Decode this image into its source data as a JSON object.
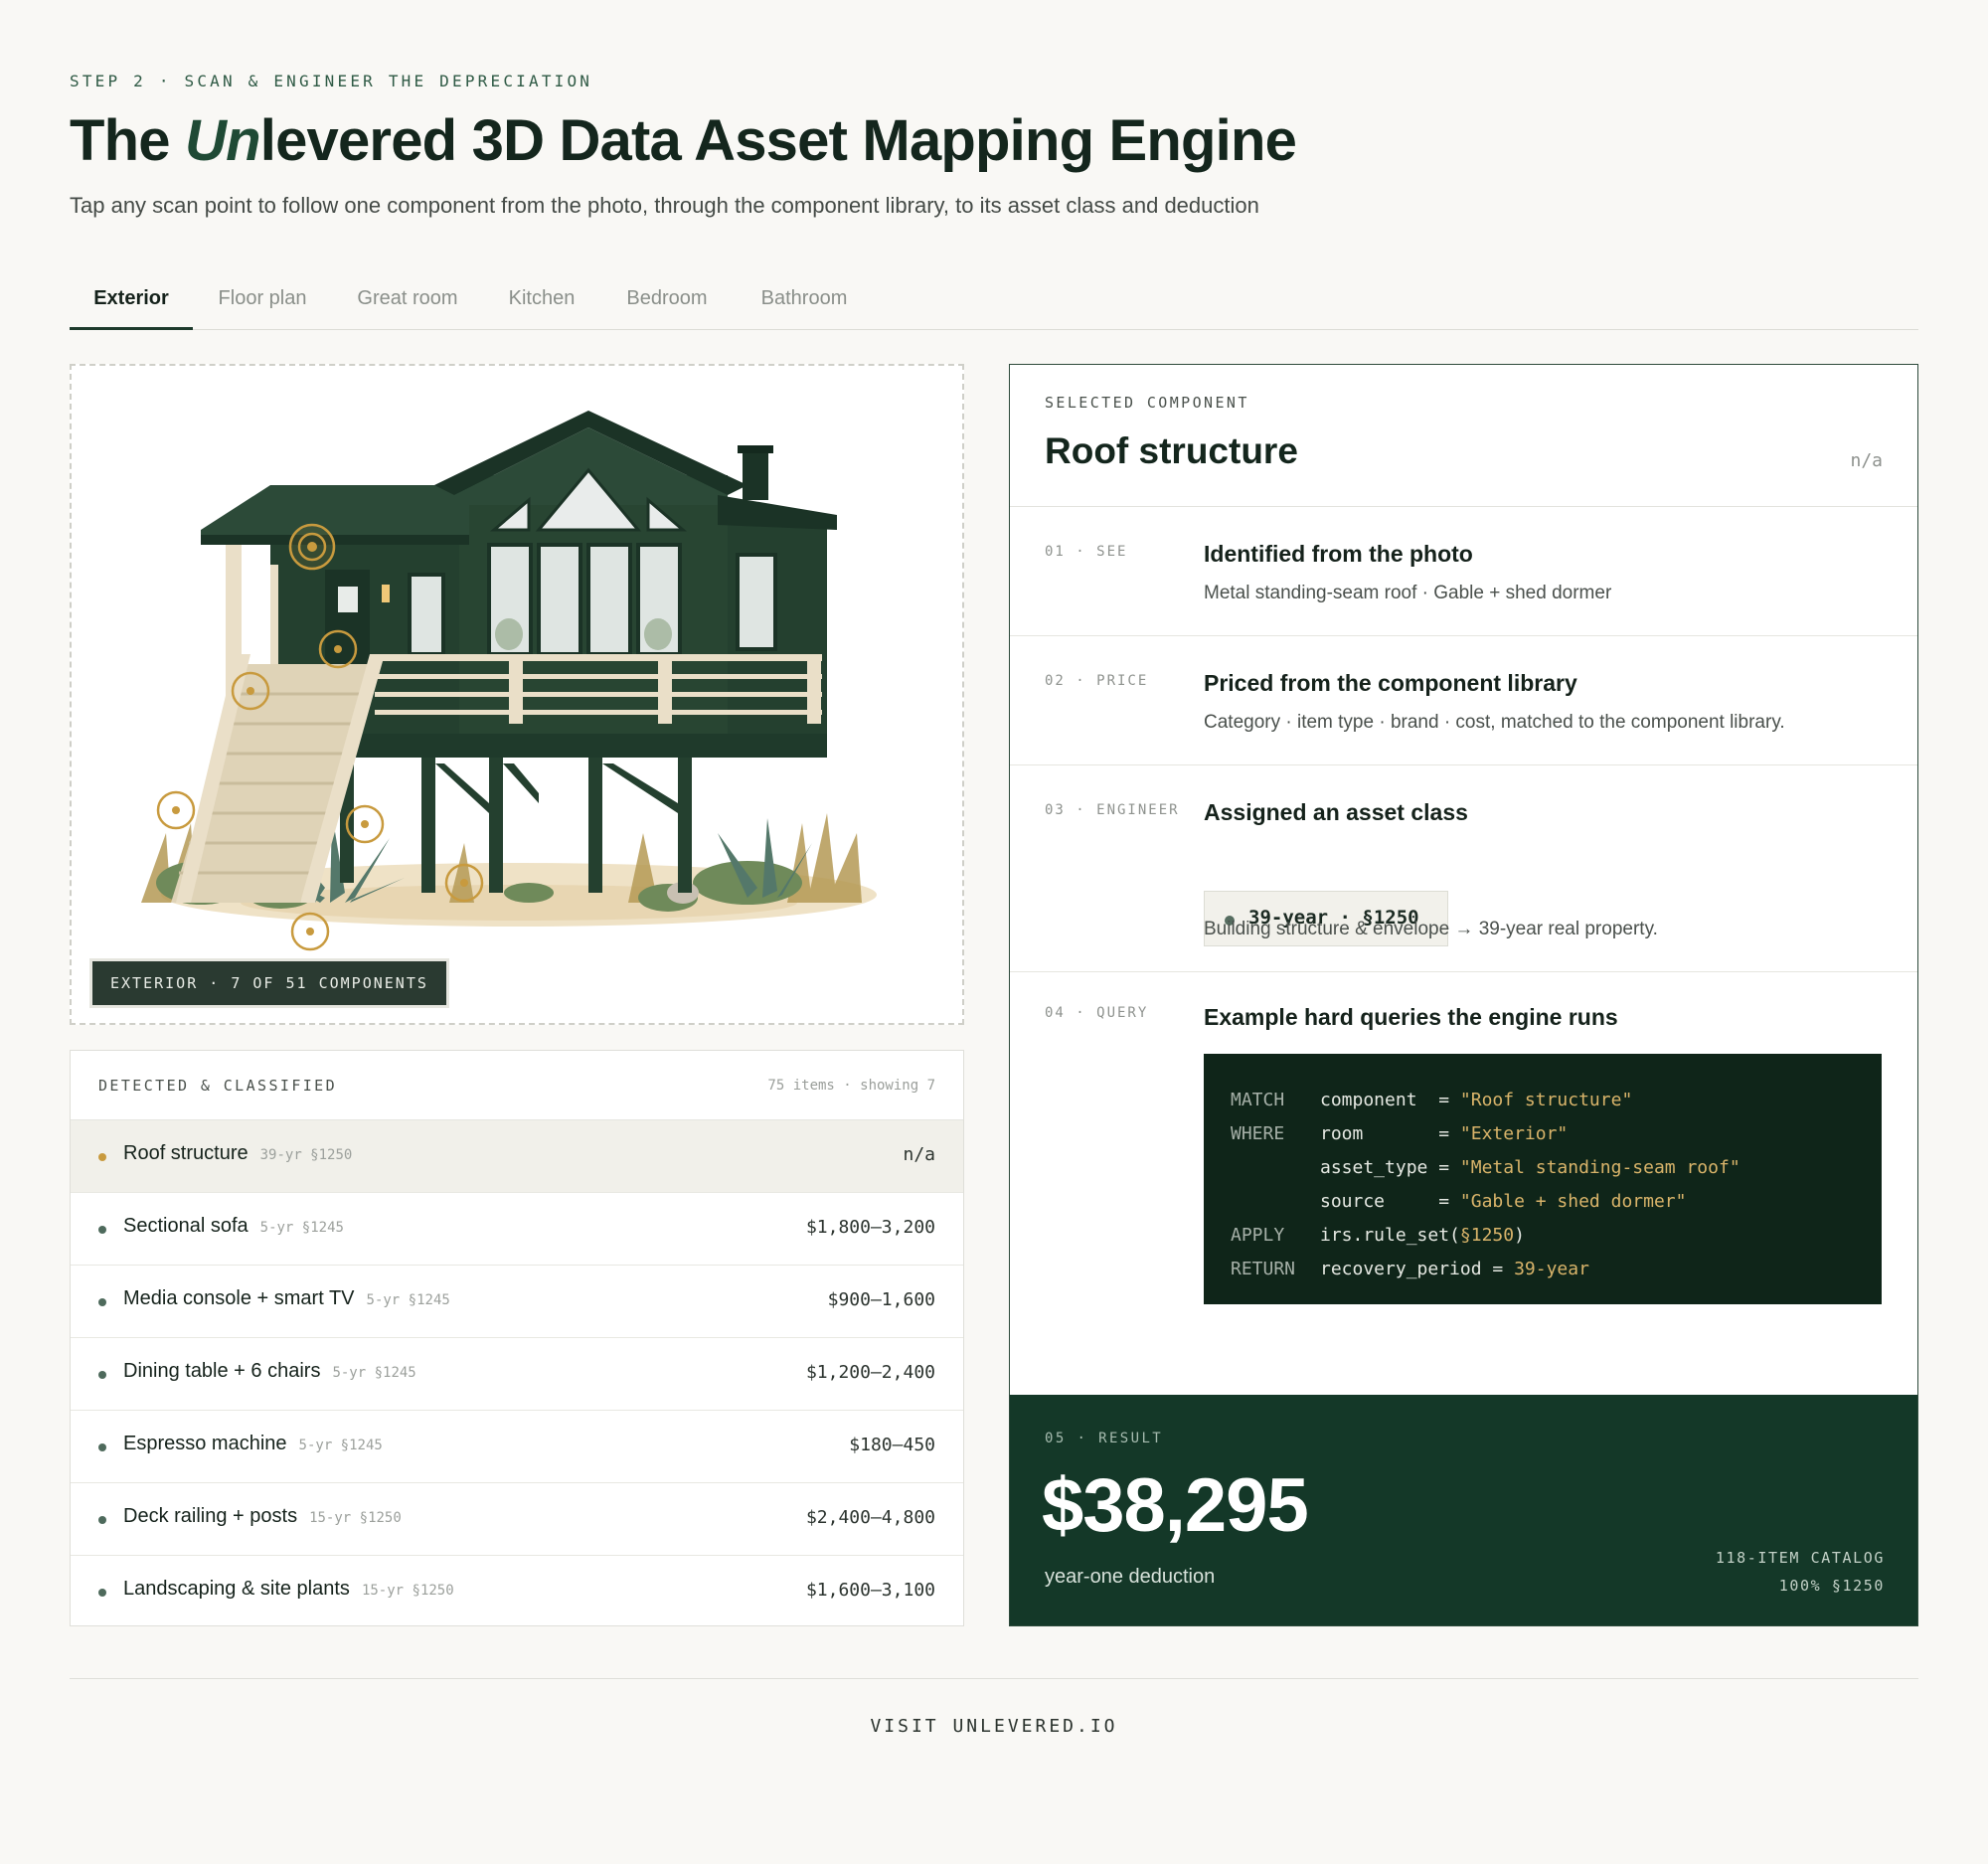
{
  "header": {
    "eyebrow": "STEP 2 · SCAN & ENGINEER THE DEPRECIATION",
    "title_prefix": "The ",
    "title_brand_italic": "Un",
    "title_rest": "levered 3D Data Asset Mapping Engine",
    "subtitle": "Tap any scan point to follow one component from the photo, through the component library, to its asset class and deduction"
  },
  "tabs": [
    {
      "label": "Exterior",
      "active": true
    },
    {
      "label": "Floor plan",
      "active": false
    },
    {
      "label": "Great room",
      "active": false
    },
    {
      "label": "Kitchen",
      "active": false
    },
    {
      "label": "Bedroom",
      "active": false
    },
    {
      "label": "Bathroom",
      "active": false
    }
  ],
  "image_panel": {
    "tag": "EXTERIOR · 7 OF 51 COMPONENTS"
  },
  "detected": {
    "label": "DETECTED & CLASSIFIED",
    "count": "75 items · showing 7",
    "rows": [
      {
        "name": "Roof structure",
        "cls": "39-yr §1250",
        "price": "n/a",
        "selected": true
      },
      {
        "name": "Sectional sofa",
        "cls": "5-yr §1245",
        "price": "$1,800–3,200",
        "selected": false
      },
      {
        "name": "Media console + smart TV",
        "cls": "5-yr §1245",
        "price": "$900–1,600",
        "selected": false
      },
      {
        "name": "Dining table + 6 chairs",
        "cls": "5-yr §1245",
        "price": "$1,200–2,400",
        "selected": false
      },
      {
        "name": "Espresso machine",
        "cls": "5-yr §1245",
        "price": "$180–450",
        "selected": false
      },
      {
        "name": "Deck railing + posts",
        "cls": "15-yr §1250",
        "price": "$2,400–4,800",
        "selected": false
      },
      {
        "name": "Landscaping & site plants",
        "cls": "15-yr §1250",
        "price": "$1,600–3,100",
        "selected": false
      }
    ]
  },
  "component": {
    "label": "SELECTED COMPONENT",
    "name": "Roof structure",
    "na": "n/a",
    "see": {
      "num": "01 · SEE",
      "title": "Identified from the photo",
      "desc": "Metal standing-seam roof · Gable + shed dormer"
    },
    "price": {
      "num": "02 · PRICE",
      "title": "Priced from the component library",
      "desc": "Category · item type · brand · cost, matched to the component library."
    },
    "engineer": {
      "num": "03 · ENGINEER",
      "title": "Assigned an asset class",
      "badge": "39-year · §1250",
      "desc": "Building structure & envelope → 39-year real property."
    },
    "query": {
      "num": "04 · QUERY",
      "title": "Example hard queries the engine runs",
      "lines": [
        {
          "kw": "MATCH",
          "lhs": "component  = ",
          "val": "\"Roof structure\""
        },
        {
          "kw": "WHERE",
          "lhs": "room       = ",
          "val": "\"Exterior\""
        },
        {
          "kw": "",
          "lhs": "asset_type = ",
          "val": "\"Metal standing-seam roof\""
        },
        {
          "kw": "",
          "lhs": "source     = ",
          "val": "\"Gable + shed dormer\""
        },
        {
          "kw": "APPLY",
          "lhs": "irs.rule_set(",
          "val": "§1250",
          "tail": ")"
        },
        {
          "kw": "RETURN",
          "lhs": "recovery_period = ",
          "val": "39-year"
        }
      ]
    },
    "result": {
      "num": "05 · RESULT",
      "amount": "$38,295",
      "sub": "year-one deduction",
      "catalog": "118-ITEM CATALOG",
      "pct": "100% §1250"
    }
  },
  "footer": {
    "cta": "VISIT UNLEVERED.IO"
  },
  "colors": {
    "brand_dark": "#143828",
    "code_bg": "#0f2519",
    "accent_gold": "#c89a3e",
    "house_green": "#24402f"
  }
}
